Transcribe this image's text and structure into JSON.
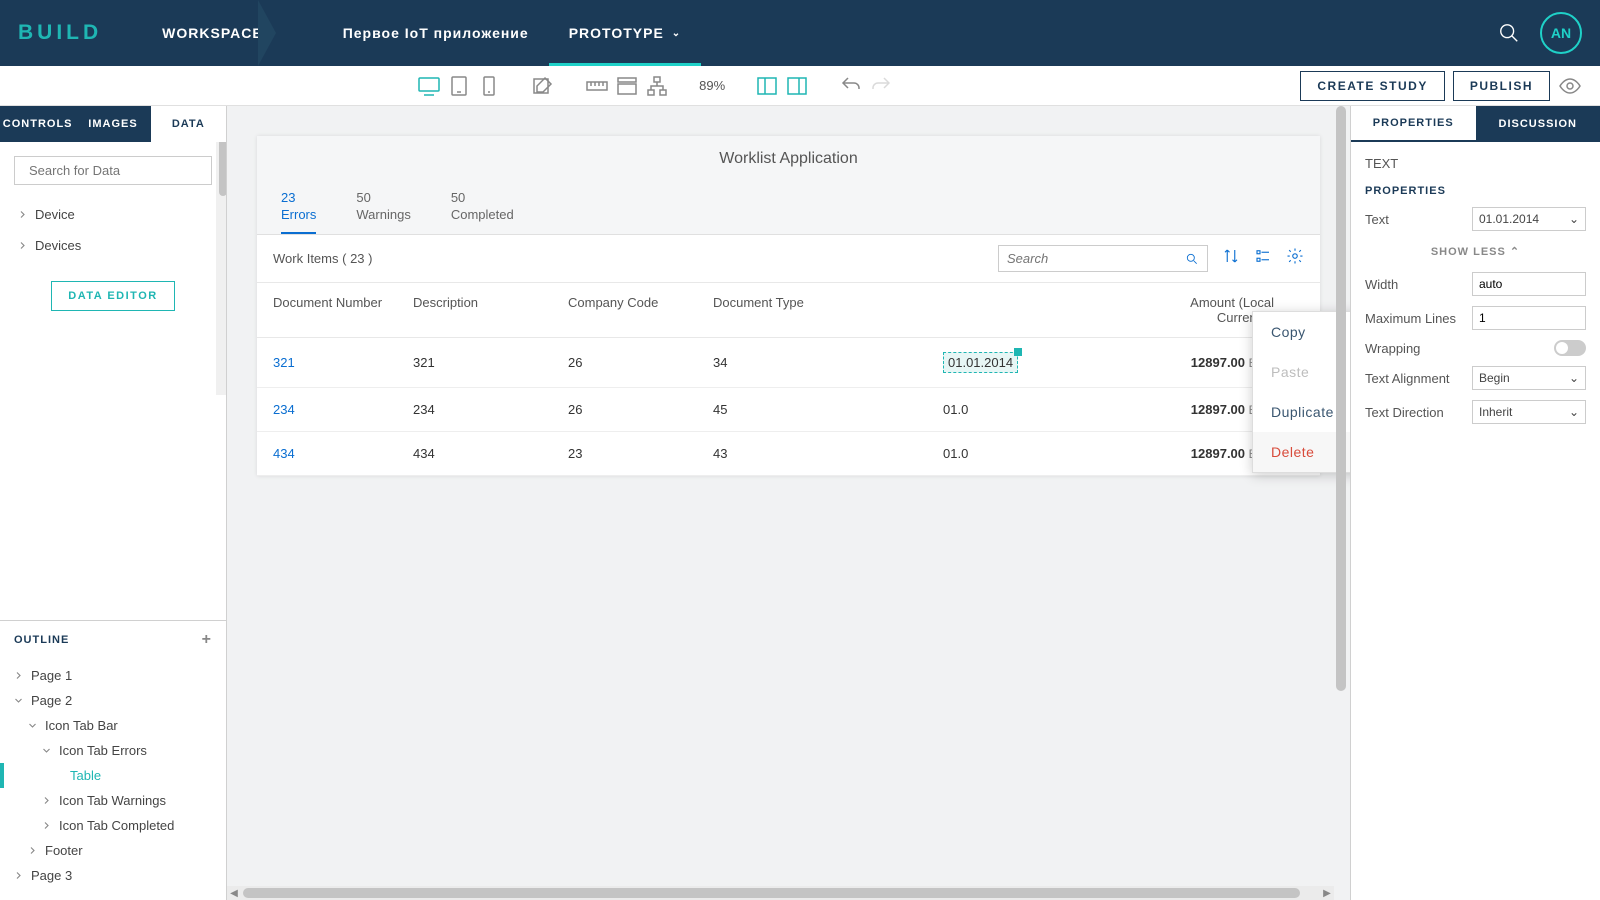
{
  "topnav": {
    "logo": "BUILD",
    "workspace": "WORKSPACE",
    "app_name": "Первое IoT приложение",
    "prototype": "PROTOTYPE",
    "avatar": "AN"
  },
  "toolbar": {
    "zoom": "89%",
    "create_study": "CREATE STUDY",
    "publish": "PUBLISH"
  },
  "left": {
    "tabs": [
      "CONTROLS",
      "IMAGES",
      "DATA"
    ],
    "search_placeholder": "Search for Data",
    "tree": [
      "Device",
      "Devices"
    ],
    "data_editor": "DATA EDITOR"
  },
  "outline": {
    "title": "OUTLINE",
    "items": {
      "page1": "Page 1",
      "page2": "Page 2",
      "icontabbar": "Icon Tab Bar",
      "icontab_errors": "Icon Tab Errors",
      "table": "Table",
      "icontab_warnings": "Icon Tab Warnings",
      "icontab_completed": "Icon Tab Completed",
      "footer": "Footer",
      "page3": "Page 3"
    }
  },
  "app": {
    "title": "Worklist Application",
    "tabs": [
      {
        "count": "23",
        "label": "Errors"
      },
      {
        "count": "50",
        "label": "Warnings"
      },
      {
        "count": "50",
        "label": "Completed"
      }
    ],
    "table_title_prefix": "Work Items (",
    "table_count": "23",
    "table_title_suffix": ")",
    "search_placeholder": "Search",
    "columns": [
      "Document Number",
      "Description",
      "Company Code",
      "Document Type",
      "Amount (Local Currency)"
    ],
    "rows": [
      {
        "doc": "321",
        "desc": "321",
        "cc": "26",
        "dt": "34",
        "date": "01.01.2014",
        "amt": "12897.00",
        "cur": "EUR"
      },
      {
        "doc": "234",
        "desc": "234",
        "cc": "26",
        "dt": "45",
        "date": "01.0",
        "amt": "12897.00",
        "cur": "EUR"
      },
      {
        "doc": "434",
        "desc": "434",
        "cc": "23",
        "dt": "43",
        "date": "01.0",
        "amt": "12897.00",
        "cur": "EUR"
      }
    ]
  },
  "ctx": {
    "copy": "Copy",
    "paste": "Paste",
    "duplicate": "Duplicate",
    "delete": "Delete"
  },
  "right": {
    "tabs": [
      "PROPERTIES",
      "DISCUSSION"
    ],
    "type_label": "TEXT",
    "section": "PROPERTIES",
    "text_label": "Text",
    "text_value": "01.01.2014",
    "show_less": "SHOW LESS",
    "width_label": "Width",
    "width_value": "auto",
    "maxlines_label": "Maximum Lines",
    "maxlines_value": "1",
    "wrapping_label": "Wrapping",
    "align_label": "Text Alignment",
    "align_value": "Begin",
    "dir_label": "Text Direction",
    "dir_value": "Inherit"
  }
}
